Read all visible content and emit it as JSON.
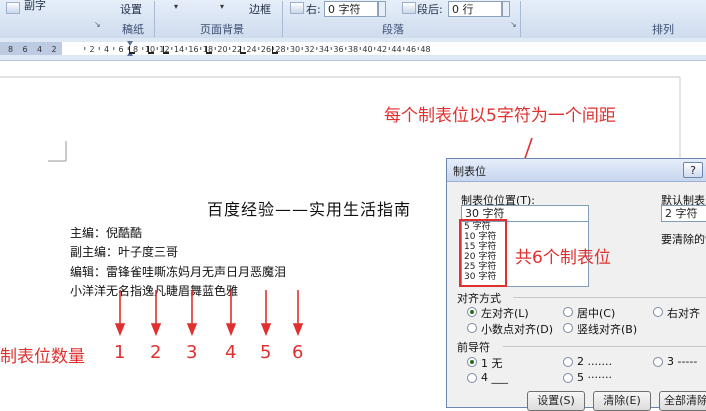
{
  "ribbon": {
    "top_cut_text": "副字",
    "settings_label": "设置",
    "border_label": "边框",
    "right_label": "右:",
    "right_value": "0 字符",
    "after_label": "段后:",
    "after_value": "0 行",
    "groups": {
      "draft": "稿纸",
      "page_background": "页面背景",
      "paragraph": "段落",
      "arrange": "排列"
    }
  },
  "ruler": {
    "left_numbers": [
      "8",
      "6",
      "4",
      "2"
    ],
    "main_numbers": [
      "2",
      "4",
      "6",
      "8",
      "10",
      "12",
      "14",
      "16",
      "18",
      "20",
      "22",
      "24",
      "26",
      "28",
      "30",
      "32",
      "34",
      "36",
      "38",
      "40",
      "42",
      "44",
      "46",
      "48"
    ]
  },
  "document": {
    "title": "百度经验——实用生活指南",
    "lines": [
      "主编：倪酷酷",
      "副主编：叶子度三哥",
      "编辑：雷锋雀哇嘶冻妈月无声日月恶魔泪",
      "小洋洋无名指逸凡睫眉舞蓝色雅"
    ]
  },
  "annotations": {
    "interval_note": "每个制表位以5字符为一个间距",
    "count_note": "共6个制表位",
    "tab_count_label": "制表位数量",
    "tab_numbers": [
      "1",
      "2",
      "3",
      "4",
      "5",
      "6"
    ],
    "color": "#e03030"
  },
  "dialog": {
    "title": "制表位",
    "help_button": "?",
    "position_label": "制表位位置(T):",
    "position_value": "30 字符",
    "tabstops": [
      "5 字符",
      "10 字符",
      "15 字符",
      "20 字符",
      "25 字符",
      "30 字符"
    ],
    "default_label": "默认制表",
    "default_value": "2 字符",
    "clear_label": "要清除的制",
    "alignment_label": "对齐方式",
    "alignment": {
      "left": "左对齐(L)",
      "center": "居中(C)",
      "right": "右对齐",
      "decimal": "小数点对齐(D)",
      "bar": "竖线对齐(B)"
    },
    "leader_label": "前导符",
    "leader": {
      "l1": "1 无",
      "l2": "2 .......",
      "l3": "3 -----",
      "l4": "4 ___",
      "l5": "5 ·······"
    },
    "buttons": {
      "set": "设置(S)",
      "clear": "清除(E)",
      "clear_all": "全部清除"
    }
  }
}
